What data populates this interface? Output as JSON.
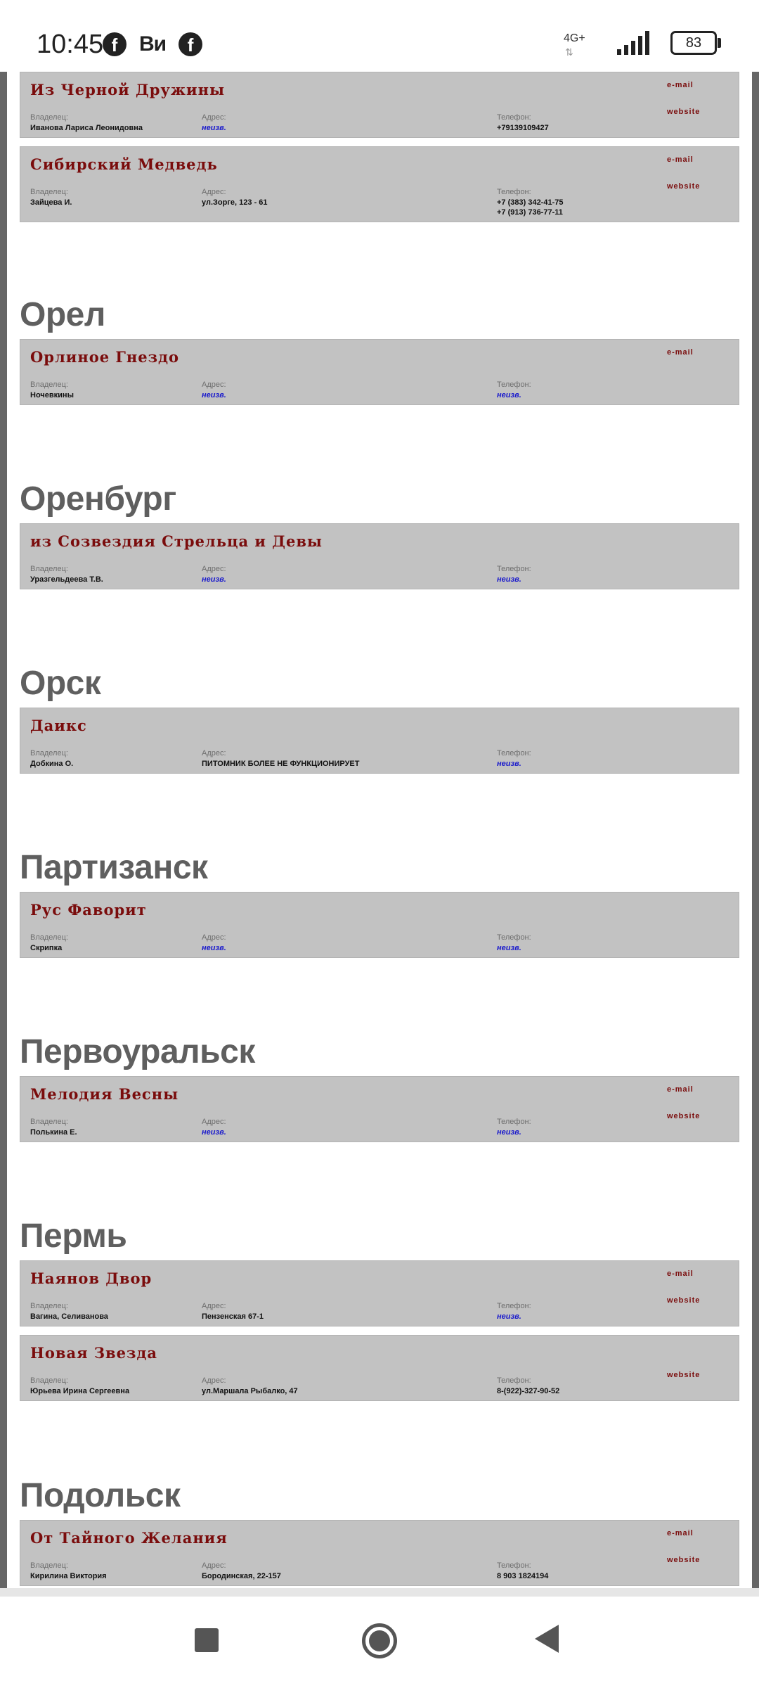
{
  "status_bar": {
    "time": "10:45",
    "app_icons": [
      "facebook-icon",
      "vk-icon",
      "facebook-icon"
    ],
    "vk_label": "Ви",
    "network": "4G+",
    "battery": "83"
  },
  "labels": {
    "owner": "Владелец:",
    "address": "Адрес:",
    "phone": "Телефон:",
    "email": "e-mail",
    "website": "website"
  },
  "sections": [
    {
      "city": "",
      "cards": [
        {
          "name": "Из Черной Дружины",
          "owner": "Иванова Лариса Леонидовна",
          "address": "неизв.",
          "phones": [
            "+79139109427"
          ],
          "email": true,
          "website": true
        },
        {
          "name": "Сибирский Медведь",
          "owner": "Зайцева И.",
          "address": "ул.Зорге, 123 - 61",
          "phones": [
            "+7 (383) 342-41-75",
            "+7 (913) 736-77-11"
          ],
          "email": true,
          "website": true
        }
      ]
    },
    {
      "city": "Орел",
      "cards": [
        {
          "name": "Орлиное Гнездо",
          "owner": "Ночевкины",
          "address": "неизв.",
          "phones": [
            "неизв."
          ],
          "email": true,
          "website": false
        }
      ]
    },
    {
      "city": "Оренбург",
      "cards": [
        {
          "name": "из Созвездия Стрельца и Девы",
          "owner": "Уразгельдеева Т.В.",
          "address": "неизв.",
          "phones": [
            "неизв."
          ],
          "email": false,
          "website": false
        }
      ]
    },
    {
      "city": "Орск",
      "cards": [
        {
          "name": "Даикс",
          "owner": "Добкина О.",
          "address": "ПИТОМНИК БОЛЕЕ НЕ ФУНКЦИОНИРУЕТ",
          "phones": [
            "неизв."
          ],
          "email": false,
          "website": false
        }
      ]
    },
    {
      "city": "Партизанск",
      "cards": [
        {
          "name": "Рус Фаворит",
          "owner": "Скрипка",
          "address": "неизв.",
          "phones": [
            "неизв."
          ],
          "email": false,
          "website": false
        }
      ]
    },
    {
      "city": "Первоуральск",
      "cards": [
        {
          "name": "Мелодия Весны",
          "owner": "Полькина Е.",
          "address": "неизв.",
          "phones": [
            "неизв."
          ],
          "email": true,
          "website": true
        }
      ]
    },
    {
      "city": "Пермь",
      "cards": [
        {
          "name": "Наянов Двор",
          "owner": "Вагина, Селиванова",
          "address": "Пензенская 67-1",
          "phones": [
            "неизв."
          ],
          "email": true,
          "website": true
        },
        {
          "name": "Новая Звезда",
          "owner": "Юрьева Ирина Сергеевна",
          "address": "ул.Маршала Рыбалко, 47",
          "phones": [
            "8-(922)-327-90-52"
          ],
          "email": false,
          "website": true
        }
      ]
    },
    {
      "city": "Подольск",
      "cards": [
        {
          "name": "От Тайного Желания",
          "owner": "Кирилина Виктория",
          "address": "Бородинская, 22-157",
          "phones": [
            "8 903 1824194"
          ],
          "email": true,
          "website": true
        }
      ]
    }
  ]
}
